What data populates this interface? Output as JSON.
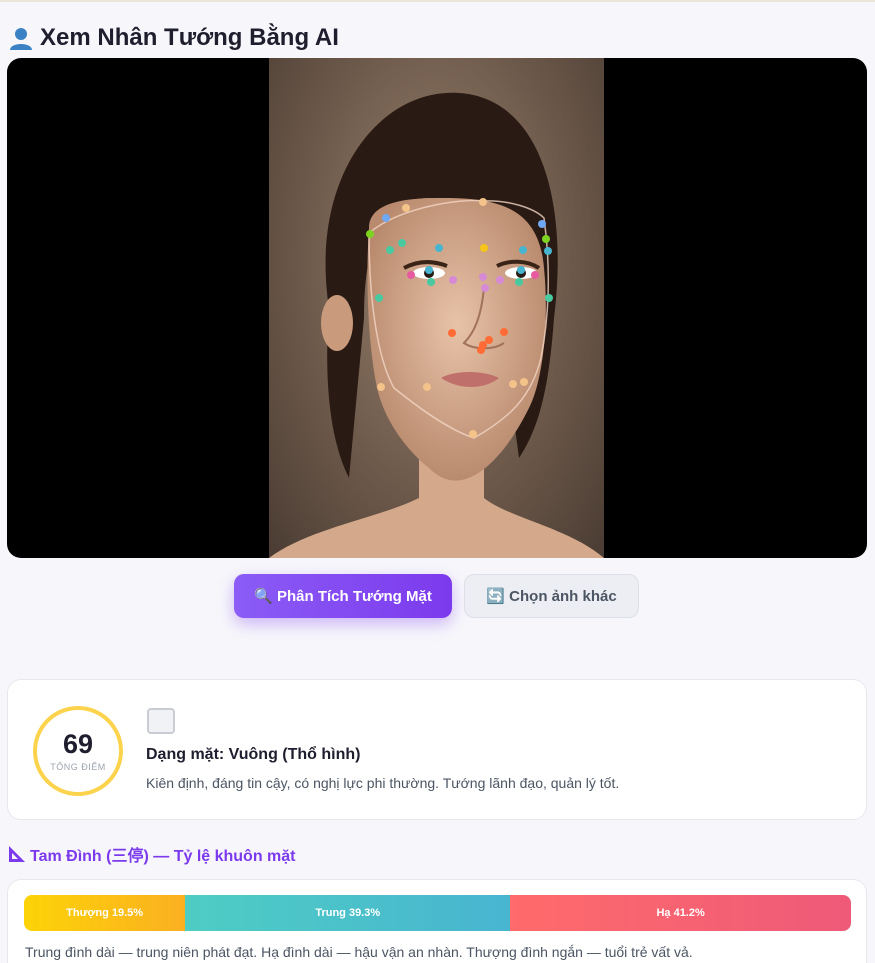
{
  "header": {
    "title": "Xem Nhân Tướng Bằng AI",
    "icon": "person-icon"
  },
  "actions": {
    "analyze_label": "🔍 Phân Tích Tướng Mặt",
    "change_label": "🔄 Chọn ảnh khác"
  },
  "result": {
    "score": "69",
    "score_label": "TỔNG ĐIỂM",
    "shape_icon": "square-icon",
    "shape_title": "Dạng mặt: Vuông (Thổ hình)",
    "shape_desc": "Kiên định, đáng tin cậy, có nghị lực phi thường. Tướng lãnh đạo, quản lý tốt."
  },
  "tam_dinh": {
    "title": "Tam Đình (三停) — Tỷ lệ khuôn mặt",
    "segments": [
      {
        "label": "Thượng 19.5%",
        "value": 19.5
      },
      {
        "label": "Trung 39.3%",
        "value": 39.3
      },
      {
        "label": "Hạ 41.2%",
        "value": 41.2
      }
    ],
    "note": "Trung đình dài — trung niên phát đạt. Hạ đình dài — hậu vận an nhàn. Thượng đình ngắn — tuổi trẻ vất vả."
  },
  "colors": {
    "accent": "#7c3aed",
    "score_ring": "#fcd34d",
    "thuong": "#fcd307",
    "trung": "#4ecdc4",
    "ha": "#ff6b6b"
  }
}
